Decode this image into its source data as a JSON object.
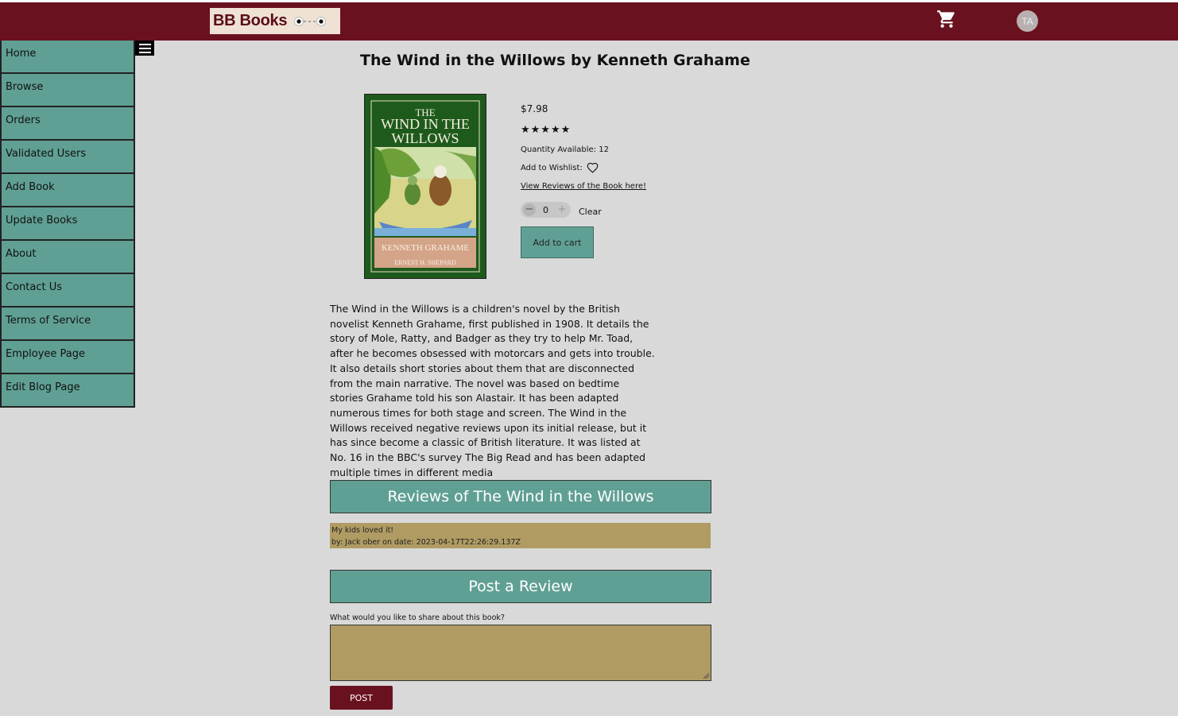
{
  "header": {
    "logo_text": "BB Books",
    "cart_icon": "shopping-cart-icon",
    "avatar_initials": "TA",
    "colors": {
      "header_bg": "#6a111f",
      "logo_bg": "#efe2d4",
      "accent_teal": "#60a094",
      "review_tan": "#b09c63",
      "page_bg": "#d9d9d9"
    }
  },
  "sidebar": {
    "menu_icon": "hamburger-menu-icon",
    "items": [
      {
        "label": "Home"
      },
      {
        "label": "Browse"
      },
      {
        "label": "Orders"
      },
      {
        "label": "Validated Users"
      },
      {
        "label": "Add Book"
      },
      {
        "label": "Update Books"
      },
      {
        "label": "About"
      },
      {
        "label": "Contact Us"
      },
      {
        "label": "Terms of Service"
      },
      {
        "label": "Employee Page"
      },
      {
        "label": "Edit Blog Page"
      }
    ]
  },
  "book": {
    "page_title": "The Wind in the Willows by Kenneth Grahame",
    "cover": {
      "line1": "THE",
      "line2": "WIND IN THE",
      "line3": "WILLOWS",
      "author": "KENNETH GRAHAME",
      "illustrator": "ERNEST H. SHEPARD"
    },
    "price": "$7.98",
    "rating_stars": "★★★★★",
    "rating": 5,
    "quantity_available": "Quantity Available: 12",
    "wishlist_label": "Add to Wishlist:",
    "wishlist_icon": "heart-outline-icon",
    "reviews_link": "View Reviews of the Book here!",
    "stepper": {
      "minus": "−",
      "value": "0",
      "plus": "+"
    },
    "clear_label": "Clear",
    "add_to_cart_label": "Add to cart",
    "description": "The Wind in the Willows is a children's novel by the British novelist Kenneth Grahame, first published in 1908. It details the story of Mole, Ratty, and Badger as they try to help Mr. Toad, after he becomes obsessed with motorcars and gets into trouble. It also details short stories about them that are disconnected from the main narrative. The novel was based on bedtime stories Grahame told his son Alastair. It has been adapted numerous times for both stage and screen. The Wind in the Willows received negative reviews upon its initial release, but it has since become a classic of British literature. It was listed at No. 16 in the BBC's survey The Big Read and has been adapted multiple times in different media"
  },
  "reviews": {
    "heading": "Reviews of The Wind in the Willows",
    "items": [
      {
        "text": "My kids loved it!",
        "byline": "by: Jack ober on date: 2023-04-17T22:26:29.137Z"
      }
    ]
  },
  "post_review": {
    "heading": "Post a Review",
    "prompt": "What would you like to share about this book?",
    "textarea_value": "",
    "submit_label": "POST"
  }
}
